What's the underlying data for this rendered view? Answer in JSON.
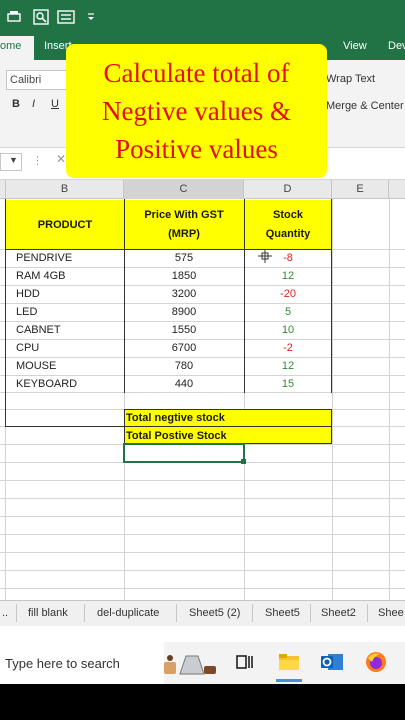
{
  "ribbon": {
    "tabs": [
      "ome",
      "Insert",
      "View",
      "Dev"
    ],
    "font_name": "Calibri",
    "bold": "B",
    "italic": "I",
    "underline": "U",
    "wrap_text": "Wrap Text",
    "merge_center": "Merge & Center"
  },
  "callout": {
    "line1": "Calculate total of",
    "line2": "Negtive values &",
    "line3": "Positive values"
  },
  "formula_bar": {
    "dots": "⋮",
    "cancel": "✕"
  },
  "columns": [
    "B",
    "C",
    "D",
    "E"
  ],
  "table": {
    "headers": {
      "product": "PRODUCT",
      "price_line1": "Price With GST",
      "price_line2": "(MRP)",
      "stock_line1": "Stock",
      "stock_line2": "Quantity"
    },
    "rows": [
      {
        "product": "PENDRIVE",
        "price": "575",
        "stock": "-8"
      },
      {
        "product": "RAM 4GB",
        "price": "1850",
        "stock": "12"
      },
      {
        "product": "HDD",
        "price": "3200",
        "stock": "-20"
      },
      {
        "product": "LED",
        "price": "8900",
        "stock": "5"
      },
      {
        "product": "CABNET",
        "price": "1550",
        "stock": "10"
      },
      {
        "product": "CPU",
        "price": "6700",
        "stock": "-2"
      },
      {
        "product": "MOUSE",
        "price": "780",
        "stock": "12"
      },
      {
        "product": "KEYBOARD",
        "price": "440",
        "stock": "15"
      }
    ],
    "total_negative_label": "Total negtive stock",
    "total_positive_label": "Total Postive  Stock"
  },
  "sheet_tabs": [
    "..",
    "fill blank",
    "del-duplicate",
    "Sheet5 (2)",
    "Sheet5",
    "Sheet2",
    "Shee"
  ],
  "taskbar": {
    "search_placeholder": "Type here to search"
  },
  "colors": {
    "excel_green": "#217346",
    "highlight": "#ffff00",
    "callout_text": "#e01010",
    "negative": "#e02020",
    "positive": "#2e8b2e"
  }
}
